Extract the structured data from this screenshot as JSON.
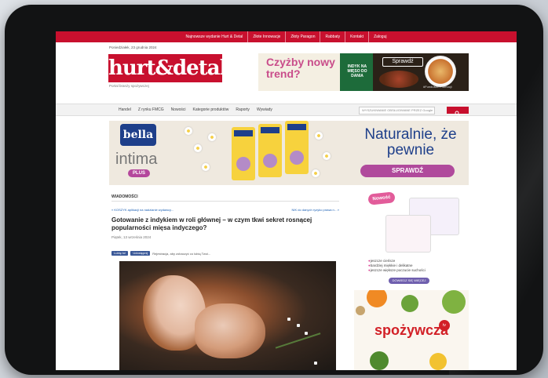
{
  "topnav": {
    "items": [
      "Najnowsze wydanie Hurt & Detal",
      "Złote Innowacje",
      "Złoty Paragon",
      "Rabbaty",
      "Kontakt",
      "Zaloguj"
    ]
  },
  "header": {
    "date": "Poniedziałek, 23 grudnia 2024",
    "logo": "hurt&detal",
    "tagline": "Portal branży spożywczej"
  },
  "header_ad": {
    "headline": "Czyżby nowy trend?",
    "green_text": "INDYK NA MIĘSO DO DANIA",
    "button": "Sprawdź",
    "footnote": "#Fundusze Promocji"
  },
  "nav": {
    "items": [
      "Handel",
      "Z rynku FMCG",
      "Nowości",
      "Kategorie produktów",
      "Raporty",
      "Wywiady"
    ],
    "search_placeholder": "WYSZUKIWANIE OBSŁUGIWANE PRZEZ Google"
  },
  "bella_ad": {
    "brand": "bella",
    "product": "intima",
    "plus": "PLUS",
    "headline": "Naturalnie, że pewnie",
    "cta": "SPRAWDŹ"
  },
  "article": {
    "section": "WIADOMOŚCI",
    "prev": "« KOSZYK aplikacji na nadzianie wydawcy...",
    "next": "NIK do danych ryzyko prawa n…»",
    "title": "Gotowanie z indykiem w roli głównej – w czym tkwi sekret rosnącej popularności mięsa indyczego?",
    "date": "Piątek, 13 września 2024",
    "share_like": "Lubię to!",
    "share_btn": "Udostępnij",
    "share_text": "Rejestracja, aby zobaczyć co lubią Twoi..."
  },
  "side_ad_1": {
    "badge": "Nowość",
    "bullets": [
      "jeszcze cieńsze",
      "bardziej miękkie i delikatne",
      "jeszcze większe poczucie suchości"
    ],
    "cta": "DOWIEDZ SIĘ WIĘCEJ"
  },
  "side_ad_2": {
    "brand": "spożywcza",
    "badge": "tv"
  }
}
